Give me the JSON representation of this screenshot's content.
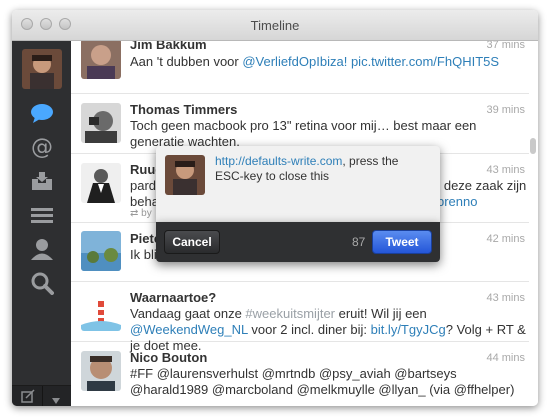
{
  "window": {
    "title": "Timeline"
  },
  "sidebar": {
    "nav": [
      "compose-bubble",
      "mentions",
      "messages",
      "lists",
      "profile",
      "search"
    ]
  },
  "tweets": [
    {
      "name": "Jim Bakkum",
      "time": "37 mins",
      "text_plain": "Aan 't dubben voor ",
      "mention": "@VerliefdOpIbiza!",
      "link": "pic.twitter.com/FhQHIT5S"
    },
    {
      "name": "Thomas Timmers",
      "time": "39 mins",
      "text": "Toch geen macbook pro 13\" retina voor mij… best maar een generatie wachten."
    },
    {
      "name": "Ruud",
      "time": "43 mins",
      "text_line1": "pardo",
      "text_line1_right": "n deze zaak zijn",
      "text_line2": "beha",
      "text_line2_right": "brenno",
      "retweet_prefix": "by"
    },
    {
      "name": "Piete",
      "time": "42 mins",
      "text_line1": "Ik bli"
    },
    {
      "name": "Waarnaartoe?",
      "time": "43 mins",
      "text_a": "Vandaag gaat onze ",
      "hashtag": "#weekuitsmijter",
      "text_b": " eruit! Wil jij een ",
      "mention": "@WeekendWeg_NL",
      "text_c": " voor 2 incl. diner bij: ",
      "link": "bit.ly/TgyJCg",
      "text_d": "? Volg + RT & je doet mee."
    },
    {
      "name": "Nico Bouton",
      "time": "44 mins",
      "text": "#FF @laurensverhulst @mrtndb @psy_aviah @bartseys @harald1989 @marcboland @melkmuylle @llyan_ (via @ffhelper)"
    }
  ],
  "compose": {
    "link": "http://defaults-write.com",
    "text": ", press the ESC-key to close this",
    "cancel_label": "Cancel",
    "char_count": "87",
    "tweet_label": "Tweet"
  },
  "colors": {
    "link": "#2e7fb8",
    "sidebar": "#2e2f31",
    "tweet_button": "#2f62e0"
  }
}
